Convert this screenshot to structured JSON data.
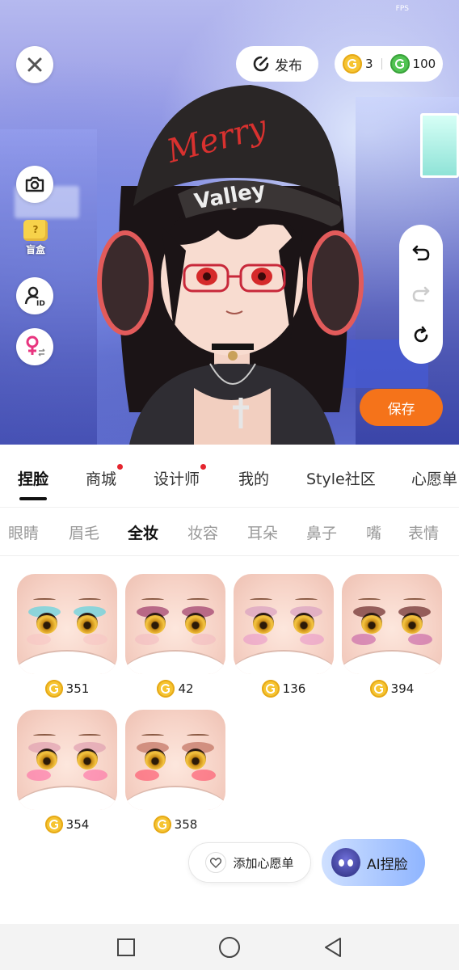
{
  "status": {
    "fps_label": "FPS"
  },
  "toolbar": {
    "publish_label": "发布",
    "gold_count": "3",
    "green_count": "100",
    "blindbox_label": "盲盒",
    "save_label": "保存"
  },
  "main_tabs": [
    {
      "label": "捏脸",
      "active": true,
      "dot": false
    },
    {
      "label": "商城",
      "active": false,
      "dot": true
    },
    {
      "label": "设计师",
      "active": false,
      "dot": true
    },
    {
      "label": "我的",
      "active": false,
      "dot": false
    },
    {
      "label": "Style社区",
      "active": false,
      "dot": false
    },
    {
      "label": "心愿单",
      "active": false,
      "dot": false
    }
  ],
  "sub_tabs": [
    {
      "label": "眼睛",
      "active": false
    },
    {
      "label": "眉毛",
      "active": false
    },
    {
      "label": "全妆",
      "active": true
    },
    {
      "label": "妆容",
      "active": false
    },
    {
      "label": "耳朵",
      "active": false
    },
    {
      "label": "鼻子",
      "active": false
    },
    {
      "label": "嘴",
      "active": false
    },
    {
      "label": "表情",
      "active": false
    }
  ],
  "makeup_items": [
    {
      "price": "351",
      "shadow": "#5fd3e0",
      "blush": "#f7c2c2",
      "lip": "#d7c8cc"
    },
    {
      "price": "42",
      "shadow": "#9c3a6a",
      "blush": "#f2b8c0",
      "lip": "#b53b3b"
    },
    {
      "price": "136",
      "shadow": "#d9a0c0",
      "blush": "#e88fc8",
      "lip": "#d92b2b"
    },
    {
      "price": "394",
      "shadow": "#6a2a2a",
      "blush": "#c04fa0",
      "lip": "#b0504a"
    },
    {
      "price": "354",
      "shadow": "#e0a0b0",
      "blush": "#ff5fa0",
      "lip": "#d89088"
    },
    {
      "price": "358",
      "shadow": "#c07060",
      "blush": "#ff3b5a",
      "lip": "#d66a6a"
    }
  ],
  "actions": {
    "wishlist_label": "添加心愿单",
    "ai_label": "AI捏脸"
  },
  "colors": {
    "accent": "#f5731a",
    "coin_gold": "#f6c431",
    "coin_green": "#51c452",
    "badge_red": "#e5252e"
  }
}
